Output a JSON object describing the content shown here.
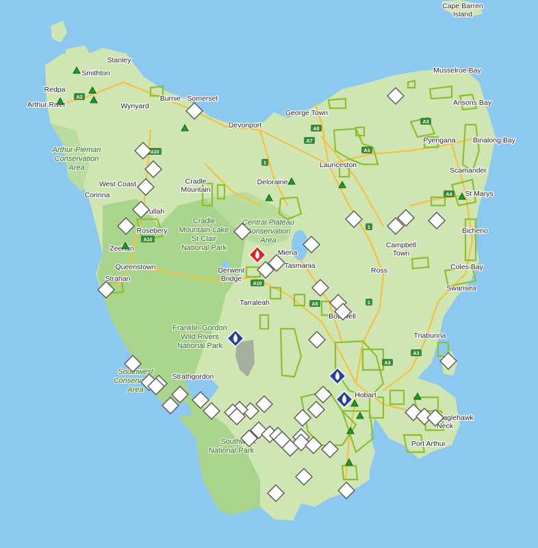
{
  "map": {
    "colors": {
      "sea": "#8dc8f0",
      "land": "#cfe6b2",
      "park": "#a8d48c",
      "reserve_outline": "#8cbf2e",
      "road": "#f5c040",
      "camp_icon": "#1e9b2a",
      "fire_red": "#e02020",
      "fire_blue": "#2a3f9a",
      "diamond": "#ffffff"
    },
    "places": [
      {
        "id": "cape-barren-island-1",
        "text": "Cape Barren"
      },
      {
        "id": "cape-barren-island-2",
        "text": "Island"
      },
      {
        "id": "stanley",
        "text": "Stanley"
      },
      {
        "id": "smithton",
        "text": "Smithton"
      },
      {
        "id": "redpa",
        "text": "Redpa"
      },
      {
        "id": "arthur-river",
        "text": "Arthur River"
      },
      {
        "id": "wynyard",
        "text": "Wynyard"
      },
      {
        "id": "burnie-somerset",
        "text": "Burnie - Somerset"
      },
      {
        "id": "devonport",
        "text": "Devonport"
      },
      {
        "id": "george-town",
        "text": "George Town"
      },
      {
        "id": "musselroe-bay",
        "text": "Musselroe Bay"
      },
      {
        "id": "ansons-bay",
        "text": "Ansons Bay"
      },
      {
        "id": "pyengana",
        "text": "Pyengana"
      },
      {
        "id": "binalong-bay",
        "text": "Binalong Bay"
      },
      {
        "id": "launceston",
        "text": "Launceston"
      },
      {
        "id": "scamander",
        "text": "Scamander"
      },
      {
        "id": "st-marys",
        "text": "St Marys"
      },
      {
        "id": "deloraine",
        "text": "Deloraine"
      },
      {
        "id": "west-coast",
        "text": "West Coast"
      },
      {
        "id": "cradle-mountain-1",
        "text": "Cradle"
      },
      {
        "id": "cradle-mountain-2",
        "text": "Mountain"
      },
      {
        "id": "corinna",
        "text": "Corinna"
      },
      {
        "id": "tullah",
        "text": "Tullah"
      },
      {
        "id": "rosebery",
        "text": "Rosebery"
      },
      {
        "id": "zeehan",
        "text": "Zeehan"
      },
      {
        "id": "queenstown",
        "text": "Queenstown"
      },
      {
        "id": "strahan",
        "text": "Strahan"
      },
      {
        "id": "miena",
        "text": "Miena"
      },
      {
        "id": "tasmania",
        "text": "Tasmania"
      },
      {
        "id": "derwent-bridge-1",
        "text": "Derwent"
      },
      {
        "id": "derwent-bridge-2",
        "text": "Bridge"
      },
      {
        "id": "tarraleah",
        "text": "Tarraleah"
      },
      {
        "id": "campbell-town-1",
        "text": "Campbell"
      },
      {
        "id": "campbell-town-2",
        "text": "Town"
      },
      {
        "id": "ross",
        "text": "Ross"
      },
      {
        "id": "bicheno",
        "text": "Bicheno"
      },
      {
        "id": "coles-bay",
        "text": "Coles Bay"
      },
      {
        "id": "swansea",
        "text": "Swansea"
      },
      {
        "id": "bothwell",
        "text": "Bothwell"
      },
      {
        "id": "triabunna",
        "text": "Triabunna"
      },
      {
        "id": "strathgordon",
        "text": "Strathgordon"
      },
      {
        "id": "hobart",
        "text": "Hobart"
      },
      {
        "id": "eaglehawk-neck-1",
        "text": "Eaglehawk"
      },
      {
        "id": "eaglehawk-neck-2",
        "text": "Neck"
      },
      {
        "id": "port-arthur",
        "text": "Port Arthur"
      }
    ],
    "parks": [
      {
        "id": "arthur-pieman-1",
        "text": "Arthur-Pieman"
      },
      {
        "id": "arthur-pieman-2",
        "text": "Conservation"
      },
      {
        "id": "arthur-pieman-3",
        "text": "Area"
      },
      {
        "id": "cradle-lake-1",
        "text": "Cradle"
      },
      {
        "id": "cradle-lake-2",
        "text": "Mountain-Lake"
      },
      {
        "id": "cradle-lake-3",
        "text": "St Clair"
      },
      {
        "id": "cradle-lake-4",
        "text": "National Park"
      },
      {
        "id": "central-plateau-1",
        "text": "Central Plateau"
      },
      {
        "id": "central-plateau-2",
        "text": "Conservation"
      },
      {
        "id": "central-plateau-3",
        "text": "Area"
      },
      {
        "id": "franklin-gordon-1",
        "text": "Franklin-Gordon"
      },
      {
        "id": "franklin-gordon-2",
        "text": "Wild Rivers"
      },
      {
        "id": "franklin-gordon-3",
        "text": "National Park"
      },
      {
        "id": "southwest-ca-1",
        "text": "Southwest"
      },
      {
        "id": "southwest-ca-2",
        "text": "Conservation"
      },
      {
        "id": "southwest-ca-3",
        "text": "Area"
      },
      {
        "id": "southwest-np-1",
        "text": "Southwest"
      },
      {
        "id": "southwest-np-2",
        "text": "National Park"
      }
    ],
    "road_shields": [
      {
        "id": "a2",
        "text": "A2"
      },
      {
        "id": "a10-north",
        "text": "A10"
      },
      {
        "id": "a8",
        "text": "A8"
      },
      {
        "id": "a7",
        "text": "A7"
      },
      {
        "id": "a3-northeast",
        "text": "A3"
      },
      {
        "id": "a3-launceston",
        "text": "A3"
      },
      {
        "id": "a4",
        "text": "A4"
      },
      {
        "id": "a10-west",
        "text": "A10"
      },
      {
        "id": "a10-central",
        "text": "A10"
      },
      {
        "id": "a5",
        "text": "A5"
      },
      {
        "id": "a3-east",
        "text": "A3"
      },
      {
        "id": "a3-southeast",
        "text": "A3"
      },
      {
        "id": "r1-a",
        "text": "1"
      },
      {
        "id": "r1-b",
        "text": "1"
      },
      {
        "id": "r1-c",
        "text": "1"
      }
    ]
  }
}
